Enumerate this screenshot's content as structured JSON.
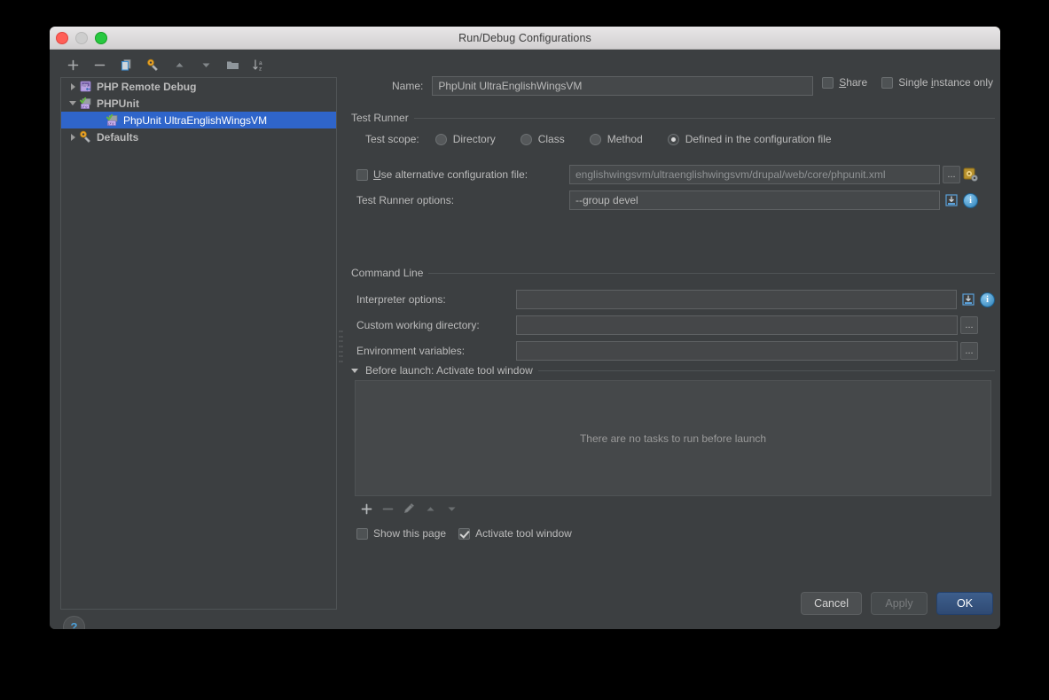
{
  "window": {
    "title": "Run/Debug Configurations"
  },
  "left_toolbar": {
    "buttons": [
      {
        "name": "add-configuration-button",
        "icon": "plus-icon",
        "label": "+"
      },
      {
        "name": "remove-configuration-button",
        "icon": "minus-icon",
        "label": "−"
      },
      {
        "name": "copy-configuration-button",
        "icon": "copy-icon",
        "label": ""
      },
      {
        "name": "edit-defaults-button",
        "icon": "wrench-icon",
        "label": ""
      },
      {
        "name": "move-up-button",
        "icon": "arrow-up-icon",
        "label": ""
      },
      {
        "name": "move-down-button",
        "icon": "arrow-down-icon",
        "label": ""
      },
      {
        "name": "create-folder-button",
        "icon": "folder-icon",
        "label": ""
      },
      {
        "name": "sort-configurations-button",
        "icon": "sort-az-icon",
        "label": ""
      }
    ]
  },
  "tree": {
    "items": [
      {
        "label": "PHP Remote Debug",
        "expanded": false,
        "selected": false,
        "icon": "php-remote-debug-icon",
        "level": 0
      },
      {
        "label": "PHPUnit",
        "expanded": true,
        "selected": false,
        "icon": "phpunit-icon",
        "level": 0
      },
      {
        "label": "PhpUnit UltraEnglishWingsVM",
        "expanded": null,
        "selected": true,
        "icon": "phpunit-icon",
        "level": 1
      },
      {
        "label": "Defaults",
        "expanded": false,
        "selected": false,
        "icon": "defaults-wrench-icon",
        "level": 0
      }
    ]
  },
  "help": {
    "label": "?"
  },
  "name_row": {
    "label": "Name:",
    "value": "PhpUnit UltraEnglishWingsVM",
    "placeholder": ""
  },
  "top_checks": {
    "share": {
      "label": "Share",
      "mnemonic": "S",
      "checked": false
    },
    "single_instance": {
      "label_before": "Single ",
      "mnemonic": "i",
      "label_after": "nstance only",
      "checked": false
    }
  },
  "test_runner": {
    "group_title": "Test Runner",
    "scope_label": "Test scope:",
    "scope_options": [
      {
        "label": "Directory",
        "selected": false
      },
      {
        "label": "Class",
        "selected": false
      },
      {
        "label": "Method",
        "selected": false
      },
      {
        "label": "Defined in the configuration file",
        "selected": true
      }
    ],
    "alt_config": {
      "checkbox_checked": false,
      "label_before": "",
      "mnemonic": "U",
      "label_after": "se alternative configuration file:",
      "value": "englishwingsvm/ultraenglishwingsvm/drupal/web/core/phpunit.xml",
      "browse_label": "...",
      "settings_icon": "config-gear-icon"
    },
    "runner_options": {
      "label": "Test Runner options:",
      "value": "--group devel",
      "expand_icon": "expand-macro-icon",
      "info_icon": "info-icon",
      "info_label": "i"
    }
  },
  "command_line": {
    "group_title": "Command Line",
    "rows": [
      {
        "label": "Interpreter options:",
        "value": "",
        "trailing": "expand-info"
      },
      {
        "label": "Custom working directory:",
        "value": "",
        "trailing": "browse"
      },
      {
        "label": "Environment variables:",
        "value": "",
        "trailing": "browse"
      }
    ],
    "browse_label": "...",
    "info_label": "i"
  },
  "before_launch": {
    "title": "Before launch: Activate tool window",
    "expanded": true,
    "empty_text": "There are no tasks to run before launch",
    "toolbar": [
      {
        "name": "add-task-button",
        "icon": "plus-icon",
        "enabled": true
      },
      {
        "name": "remove-task-button",
        "icon": "minus-icon",
        "enabled": false
      },
      {
        "name": "edit-task-button",
        "icon": "pencil-icon",
        "enabled": false
      },
      {
        "name": "move-task-up-button",
        "icon": "arrow-up-icon",
        "enabled": false
      },
      {
        "name": "move-task-down-button",
        "icon": "arrow-down-icon",
        "enabled": false
      }
    ],
    "checkboxes": [
      {
        "label": "Show this page",
        "checked": false,
        "name": "show-this-page-checkbox"
      },
      {
        "label": "Activate tool window",
        "checked": true,
        "name": "activate-tool-window-checkbox"
      }
    ]
  },
  "footer": {
    "cancel": "Cancel",
    "apply": "Apply",
    "ok": "OK",
    "apply_enabled": false
  },
  "colors": {
    "selection": "#2f65ca",
    "primary_button": "#36537f",
    "panel_bg": "#3c3f41",
    "field_bg": "#45484a",
    "text": "#bbbbbb",
    "accent_info": "#2a7fb8"
  }
}
